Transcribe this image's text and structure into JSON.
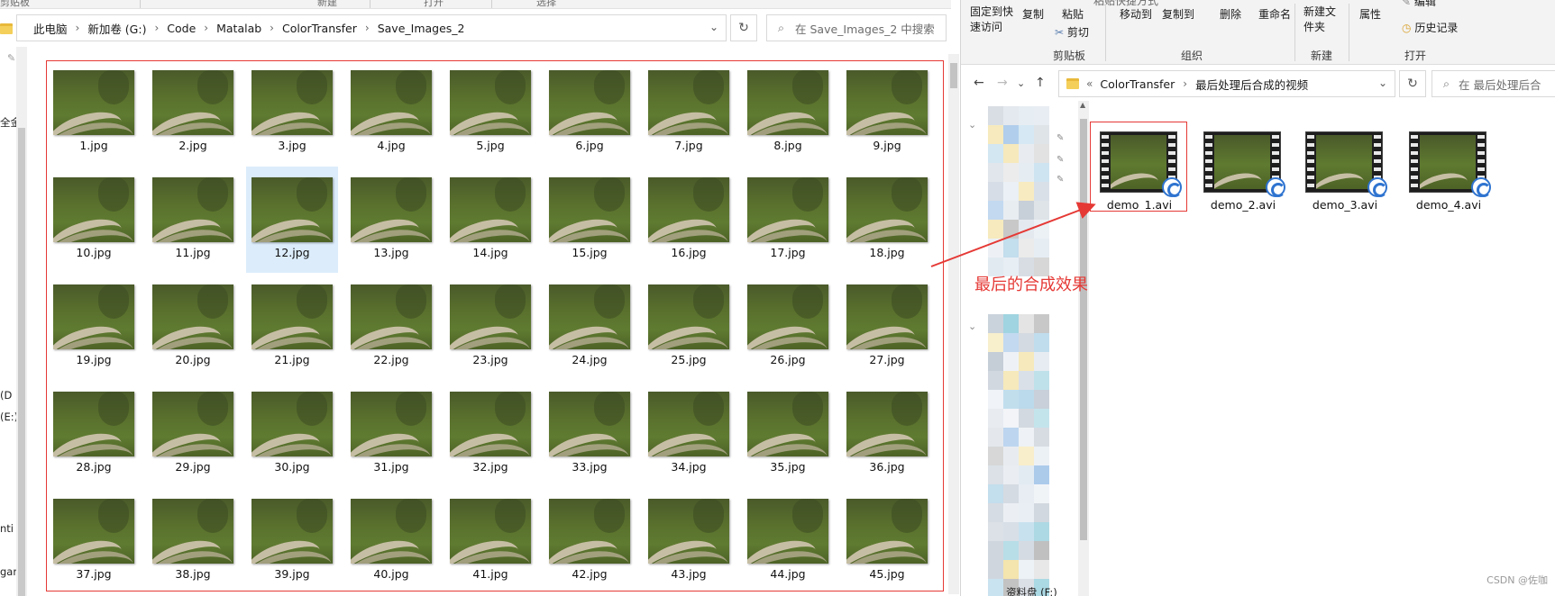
{
  "left_window": {
    "ribbon_fragments": [
      "剪贴板",
      "新建",
      "打开",
      "选择"
    ],
    "breadcrumb": [
      "此电脑",
      "新加卷 (G:)",
      "Code",
      "Matalab",
      "ColorTransfer",
      "Save_Images_2"
    ],
    "search_placeholder": "在 Save_Images_2 中搜索",
    "nav_fragments": [
      "全金",
      "(D",
      "(E:)",
      "nti",
      "gan"
    ],
    "thumbnails": [
      "1.jpg",
      "2.jpg",
      "3.jpg",
      "4.jpg",
      "5.jpg",
      "6.jpg",
      "7.jpg",
      "8.jpg",
      "9.jpg",
      "10.jpg",
      "11.jpg",
      "12.jpg",
      "13.jpg",
      "14.jpg",
      "15.jpg",
      "16.jpg",
      "17.jpg",
      "18.jpg",
      "19.jpg",
      "20.jpg",
      "21.jpg",
      "22.jpg",
      "23.jpg",
      "24.jpg",
      "25.jpg",
      "26.jpg",
      "27.jpg",
      "28.jpg",
      "29.jpg",
      "30.jpg",
      "31.jpg",
      "32.jpg",
      "33.jpg",
      "34.jpg",
      "35.jpg",
      "36.jpg",
      "37.jpg",
      "38.jpg",
      "39.jpg",
      "40.jpg",
      "41.jpg",
      "42.jpg",
      "43.jpg",
      "44.jpg",
      "45.jpg"
    ],
    "selected_thumbnail": "12.jpg"
  },
  "right_window": {
    "ribbon": {
      "pin_quick_access": "固定到快速访问",
      "copy": "复制",
      "paste": "粘贴",
      "paste_shortcut": "粘贴快捷方式",
      "cut": "剪切",
      "move_to": "移动到",
      "copy_to": "复制到",
      "delete": "删除",
      "rename": "重命名",
      "new_folder": "新建文件夹",
      "properties": "属性",
      "edit": "编辑",
      "history": "历史记录",
      "group_clipboard": "剪贴板",
      "group_organize": "组织",
      "group_new": "新建",
      "group_open": "打开"
    },
    "breadcrumb": [
      "ColorTransfer",
      "最后处理后合成的视频"
    ],
    "search_placeholder": "在 最后处理后合",
    "nav_bottom_fragment": "资料盘 (F:)",
    "videos": [
      "demo_1.avi",
      "demo_2.avi",
      "demo_3.avi",
      "demo_4.avi"
    ]
  },
  "annotation": "最后的合成效果",
  "watermark": "CSDN @佐咖",
  "colors": {
    "highlight_red": "#e53935",
    "selection_blue": "#dcecfb",
    "badge_blue": "#2f74d0"
  }
}
